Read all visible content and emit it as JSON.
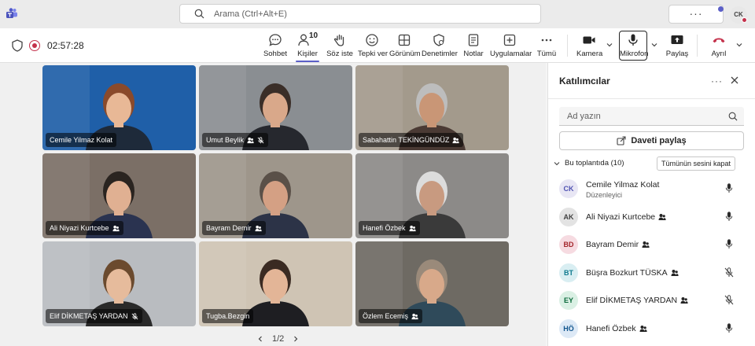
{
  "app": {
    "search_placeholder": "Arama (Ctrl+Alt+E)",
    "more_label": "···",
    "user_initials": "CK"
  },
  "meeting": {
    "timer": "02:57:28",
    "people_count": "10",
    "toolbar": [
      {
        "id": "chat",
        "label": "Sohbet",
        "icon": "chat-icon"
      },
      {
        "id": "people",
        "label": "Kişiler",
        "icon": "people-icon"
      },
      {
        "id": "raise",
        "label": "Söz iste",
        "icon": "hand-icon"
      },
      {
        "id": "react",
        "label": "Tepki ver",
        "icon": "smile-icon"
      },
      {
        "id": "view",
        "label": "Görünüm",
        "icon": "view-icon"
      },
      {
        "id": "moderate",
        "label": "Denetimler",
        "icon": "shield-settings-icon"
      },
      {
        "id": "notes",
        "label": "Notlar",
        "icon": "notes-icon"
      },
      {
        "id": "apps",
        "label": "Uygulamalar",
        "icon": "add-icon"
      },
      {
        "id": "more",
        "label": "Tümü",
        "icon": "more-icon"
      },
      {
        "id": "camera",
        "label": "Kamera",
        "icon": "camera-icon"
      },
      {
        "id": "mic",
        "label": "Mikrofon",
        "icon": "mic-icon"
      },
      {
        "id": "share",
        "label": "Paylaş",
        "icon": "share-icon"
      },
      {
        "id": "leave",
        "label": "Ayrıl",
        "icon": "phone-hangup-icon"
      }
    ]
  },
  "colors": {
    "accent": "#5b5fc7",
    "leave_red": "#c4314b"
  },
  "tiles": [
    {
      "name": "Cemile Yilmaz Kolat",
      "bg": "#1f5fa8",
      "muted": false,
      "org": false
    },
    {
      "name": "Umut Beylik",
      "bg": "#8a8e92",
      "muted": true,
      "org": true
    },
    {
      "name": "Sabahattin TEKİNGÜNDÜZ",
      "bg": "#a39a8c",
      "muted": false,
      "org": true
    },
    {
      "name": "Ali Niyazi Kurtcebe",
      "bg": "#7b6f66",
      "muted": false,
      "org": true
    },
    {
      "name": "Bayram Demir",
      "bg": "#9e968b",
      "muted": false,
      "org": true
    },
    {
      "name": "Hanefi Özbek",
      "bg": "#8c8a88",
      "muted": false,
      "org": true
    },
    {
      "name": "Elif DİKMETAŞ YARDAN",
      "bg": "#b9bcc0",
      "muted": true,
      "org": false
    },
    {
      "name": "Tugba.Bezgin",
      "bg": "#cfc4b4",
      "muted": false,
      "org": false
    },
    {
      "name": "Özlem Ecemiş",
      "bg": "#6e6a63",
      "muted": false,
      "org": true
    }
  ],
  "pager": "1/2",
  "panel": {
    "title": "Katılımcılar",
    "search_placeholder": "Ad yazın",
    "invite_label": "Daveti paylaş",
    "section_label": "Bu toplantıda (10)",
    "mute_all_label": "Tümünün sesini kapat",
    "participants": [
      {
        "initials": "CK",
        "name": "Cemile Yilmaz Kolat",
        "role": "Düzenleyici",
        "muted": false,
        "avatar_bg": "#e8e6f4",
        "avatar_fg": "#4f52b2"
      },
      {
        "initials": "AK",
        "name": "Ali Niyazi Kurtcebe",
        "role": "",
        "muted": false,
        "avatar_bg": "#e3e3e3",
        "avatar_fg": "#424242"
      },
      {
        "initials": "BD",
        "name": "Bayram Demir",
        "role": "",
        "muted": false,
        "avatar_bg": "#f6dbe1",
        "avatar_fg": "#a4262c"
      },
      {
        "initials": "BT",
        "name": "Büşra Bozkurt TÜSKA",
        "role": "",
        "muted": true,
        "avatar_bg": "#d9eef2",
        "avatar_fg": "#0e7a8f"
      },
      {
        "initials": "EY",
        "name": "Elif DİKMETAŞ YARDAN",
        "role": "",
        "muted": true,
        "avatar_bg": "#daf0e4",
        "avatar_fg": "#0b6a3b"
      },
      {
        "initials": "HÖ",
        "name": "Hanefi Özbek",
        "role": "",
        "muted": false,
        "avatar_bg": "#dde9f6",
        "avatar_fg": "#0f548c"
      }
    ]
  }
}
